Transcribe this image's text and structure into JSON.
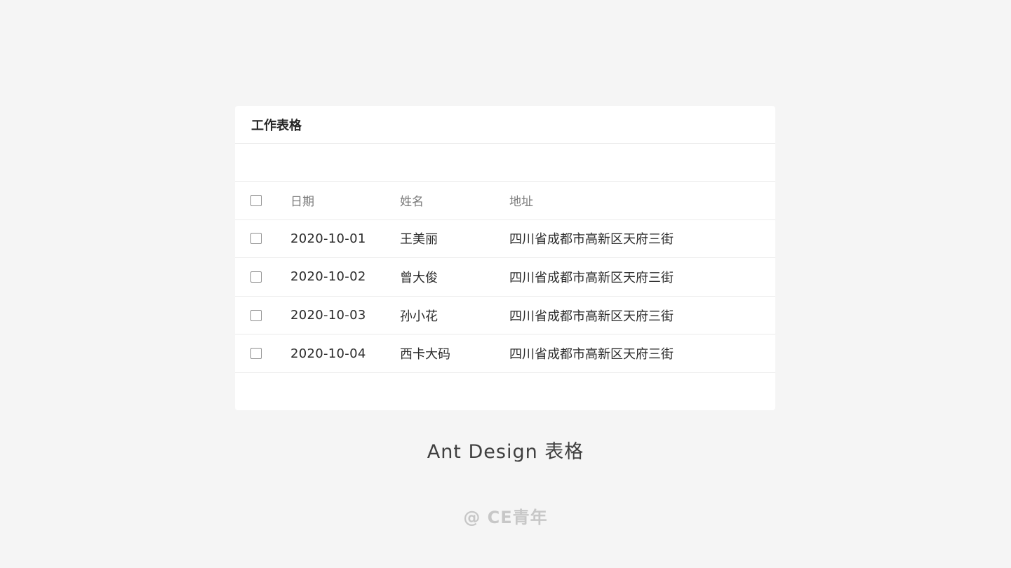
{
  "card": {
    "title": "工作表格"
  },
  "table": {
    "columns": [
      "日期",
      "姓名",
      "地址"
    ],
    "rows": [
      {
        "date": "2020-10-01",
        "name": "王美丽",
        "address": "四川省成都市高新区天府三街"
      },
      {
        "date": "2020-10-02",
        "name": "曾大俊",
        "address": "四川省成都市高新区天府三街"
      },
      {
        "date": "2020-10-03",
        "name": "孙小花",
        "address": "四川省成都市高新区天府三街"
      },
      {
        "date": "2020-10-04",
        "name": "西卡大码",
        "address": "四川省成都市高新区天府三街"
      }
    ]
  },
  "caption": "Ant Design 表格",
  "watermark": "@ CE青年",
  "colors": {
    "page_background": "#f5f5f5",
    "card_background": "#ffffff",
    "divider": "#ebebeb",
    "header_text": "#7a7a7a",
    "body_text": "#2b2b2b"
  }
}
